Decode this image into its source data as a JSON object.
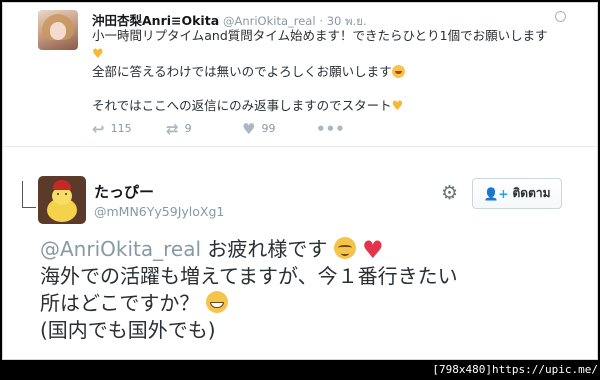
{
  "tweet1": {
    "name": "沖田杏梨Anri≡Okita",
    "handle": "@AnriOkita_real",
    "time": "· 30 พ.ย.",
    "lines": [
      "小一時間リプタイムand質問タイム始めます！できたらひとり1個でお願いします",
      "全部に答えるわけでは無いのでよろしくお願いします",
      "それではここへの返信にのみ返事しますのでスタート"
    ],
    "actions": {
      "reply_count": "115",
      "retweet_count": "9",
      "like_count": "99"
    }
  },
  "tweet2": {
    "name": "たっぴー",
    "handle": "@mMN6Yy59JyloXg1",
    "follow_label": "ติดตาม",
    "mention": "@AnriOkita_real",
    "text_a": "お疲れ様です",
    "line2": "海外での活躍も増えてますが、今１番行きたい",
    "line3": "所はどこですか？",
    "line4": "(国内でも国外でも)"
  },
  "watermark": "[798x480]https://upic.me/",
  "icons": [
    "globe-icon",
    "reply-icon",
    "retweet-icon",
    "like-icon",
    "more-icon",
    "gear-icon",
    "follow-plus-icon"
  ]
}
